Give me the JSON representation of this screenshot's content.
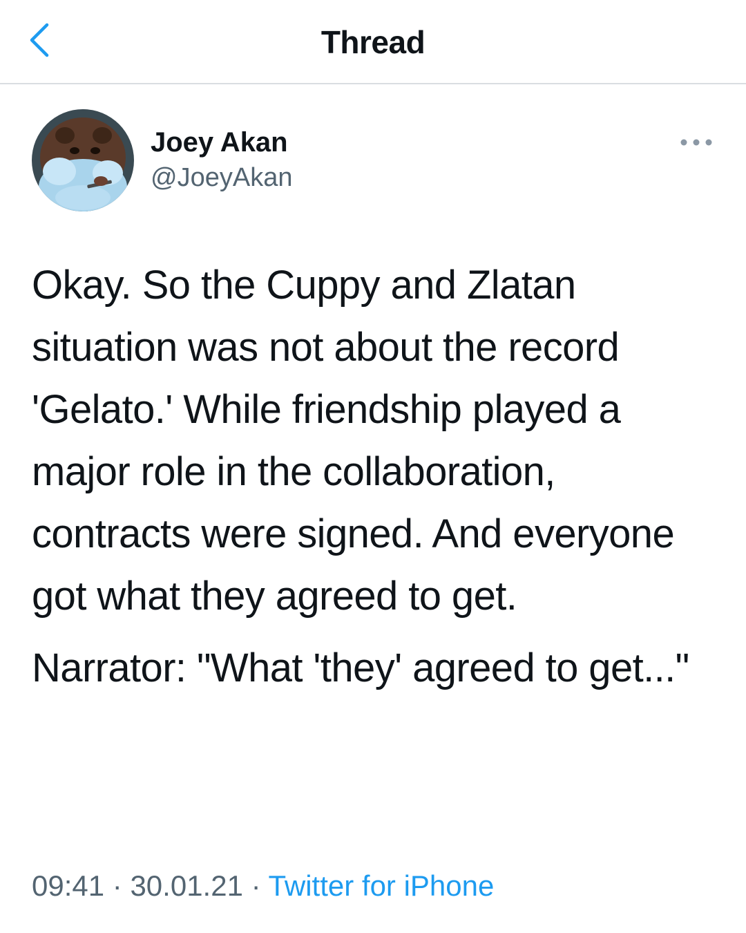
{
  "header": {
    "title": "Thread",
    "back_icon": "chevron-left-icon",
    "accent_color": "#1d9bf0"
  },
  "tweet": {
    "author": {
      "display_name": "Joey Akan",
      "handle": "@JoeyAkan"
    },
    "more_icon": "more-horizontal-icon",
    "paragraphs": [
      "Okay. So the Cuppy and Zlatan situation was not about the record 'Gelato.' While friendship played a major role in the collaboration, contracts were signed. And everyone got what they agreed to get.",
      "Narrator: \"What 'they' agreed to get...\""
    ],
    "time": "09:41",
    "separator": "·",
    "date": "30.01.21",
    "source": "Twitter for iPhone"
  }
}
